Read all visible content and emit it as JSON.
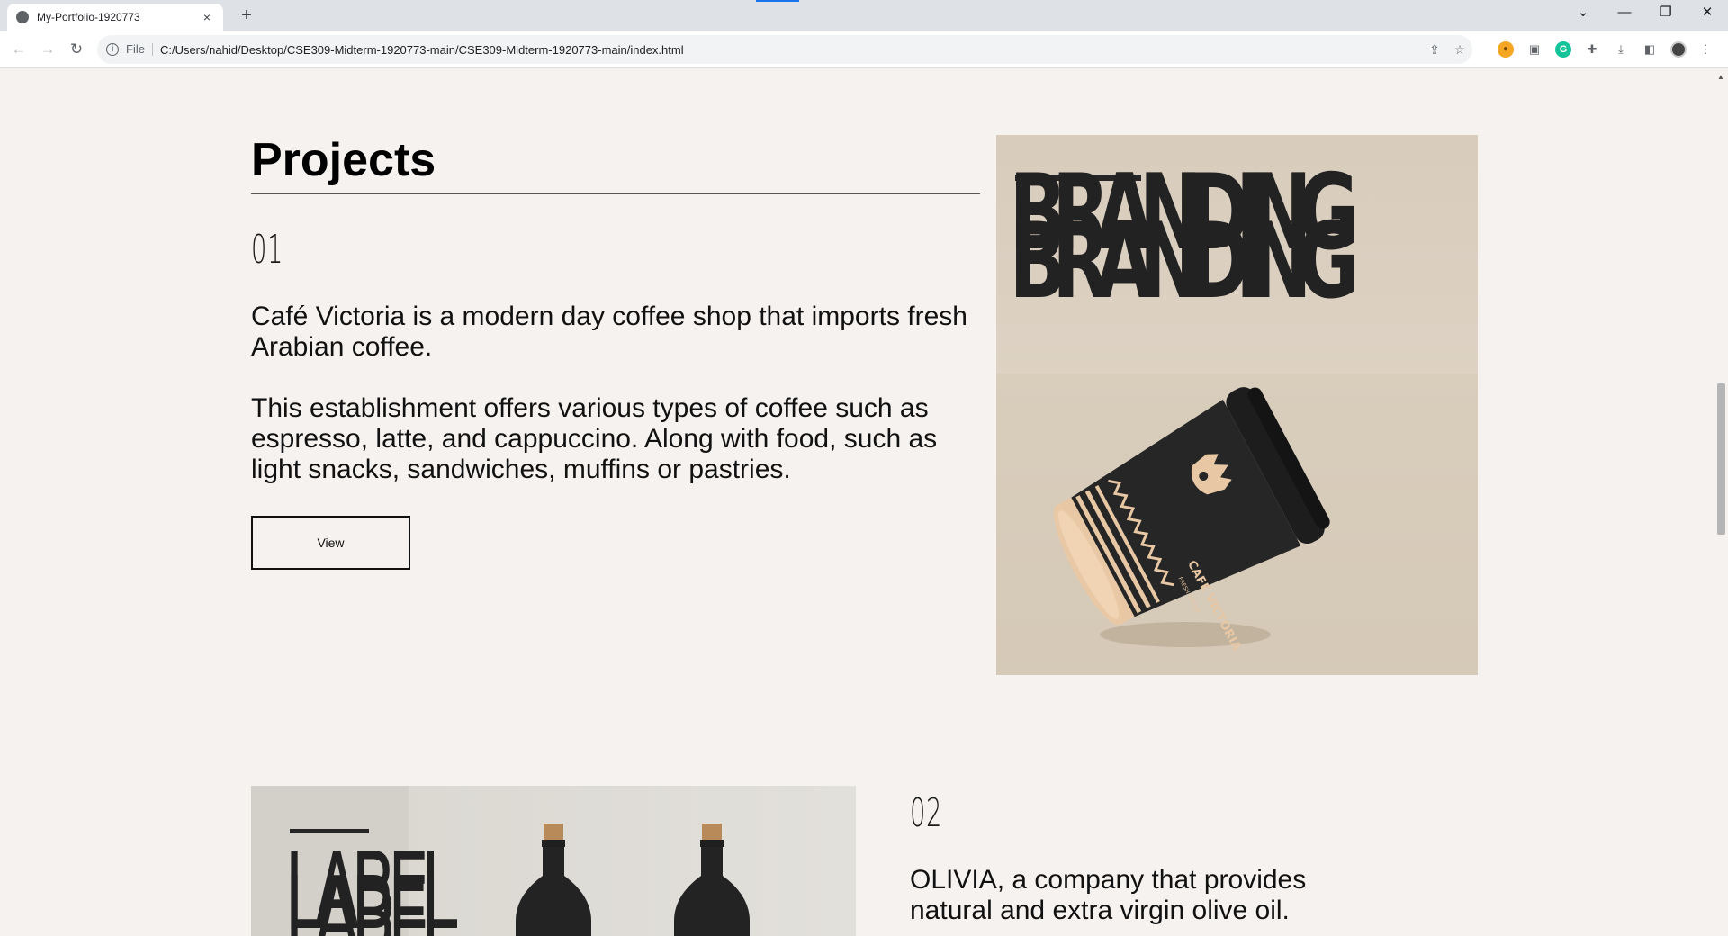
{
  "browser": {
    "tab_title": "My-Portfolio-1920773",
    "tab_close": "×",
    "new_tab": "+",
    "url_prefix": "File",
    "url": "C:/Users/nahid/Desktop/CSE309-Midterm-1920773-main/CSE309-Midterm-1920773-main/index.html"
  },
  "projects": {
    "heading": "Projects",
    "items": [
      {
        "number": "01",
        "description_1": "Café Victoria is a modern day coffee shop that imports fresh Arabian coffee.",
        "description_2": "This establishment offers various types of coffee such as espresso, latte, and cappuccino. Along with food, such as light snacks, sandwiches, muffins or pastries.",
        "button_label": "View",
        "image_heading": "BRANDING",
        "cup_brand": "CAFE VICTORIA",
        "cup_tagline": "FRESH COFFEE"
      },
      {
        "number": "02",
        "description_1": "OLIVIA, a company that provides natural and extra virgin olive oil.",
        "image_heading": "LABEL"
      }
    ]
  }
}
